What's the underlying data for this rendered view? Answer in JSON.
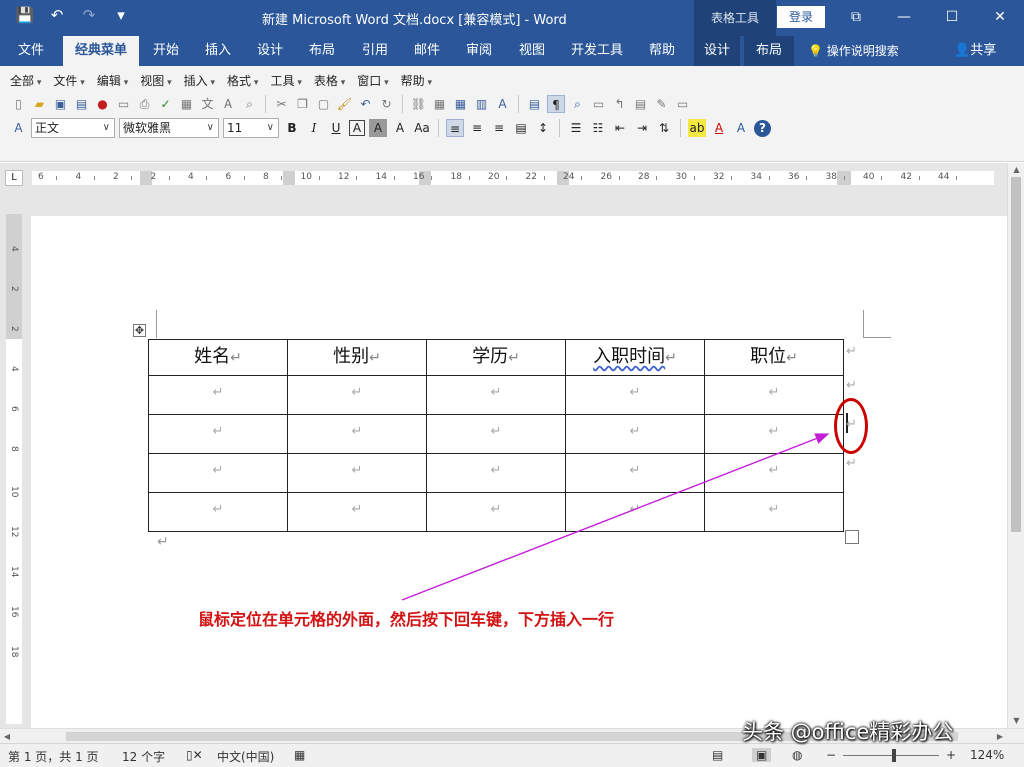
{
  "window": {
    "title": "新建 Microsoft Word 文档.docx [兼容模式]  -  Word",
    "context_tools": "表格工具",
    "login": "登录",
    "minimize": "—",
    "maximize": "☐",
    "close": "✕",
    "restore": "⧉"
  },
  "qat": {
    "save": "💾",
    "undo": "↶",
    "redo": "↷",
    "customize": "▾"
  },
  "tabs": [
    {
      "label": "文件"
    },
    {
      "label": "经典菜单"
    },
    {
      "label": "开始"
    },
    {
      "label": "插入"
    },
    {
      "label": "设计"
    },
    {
      "label": "布局"
    },
    {
      "label": "引用"
    },
    {
      "label": "邮件"
    },
    {
      "label": "审阅"
    },
    {
      "label": "视图"
    },
    {
      "label": "开发工具"
    },
    {
      "label": "帮助"
    },
    {
      "label": "设计"
    },
    {
      "label": "布局"
    }
  ],
  "tell_me": "操作说明搜索",
  "share": "共享",
  "classic_menu": [
    "全部",
    "文件",
    "编辑",
    "视图",
    "插入",
    "格式",
    "工具",
    "表格",
    "窗口",
    "帮助"
  ],
  "format": {
    "style": "正文",
    "font": "微软雅黑",
    "size": "11"
  },
  "ruler": {
    "corner": "L",
    "labels": [
      "6",
      "4",
      "2",
      "2",
      "4",
      "6",
      "8",
      "10",
      "12",
      "14",
      "16",
      "18",
      "20",
      "22",
      "24",
      "26",
      "28",
      "30",
      "32",
      "34",
      "36",
      "38",
      "40",
      "42",
      "44"
    ],
    "vlabels": [
      "4",
      "2",
      "2",
      "4",
      "6",
      "8",
      "10",
      "12",
      "14",
      "16",
      "18"
    ]
  },
  "table": {
    "headers": [
      "姓名",
      "性别",
      "学历",
      "入职时间",
      "职位"
    ],
    "mark": "↵",
    "rows": 4
  },
  "annotation": "鼠标定位在单元格的外面，然后按下回车键，下方插入一行",
  "status": {
    "page": "第 1 页，共 1 页",
    "words": "12 个字",
    "language": "中文(中国)",
    "zoom": "124%"
  },
  "watermark": "头条 @office精彩办公",
  "colors": {
    "brand": "#2b579a",
    "annotation": "#d21313"
  }
}
